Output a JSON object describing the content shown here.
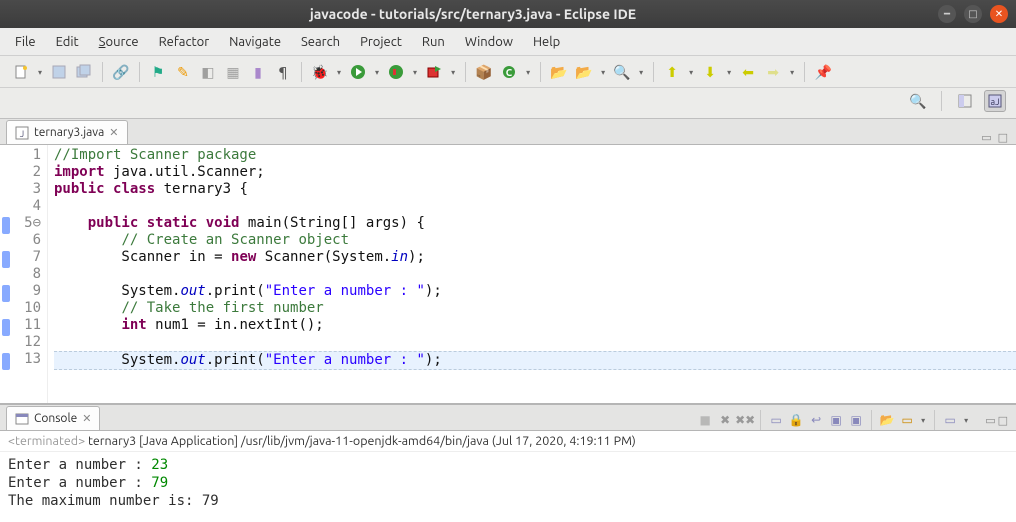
{
  "window": {
    "title": "javacode - tutorials/src/ternary3.java - Eclipse IDE"
  },
  "menu": [
    "File",
    "Edit",
    "Source",
    "Refactor",
    "Navigate",
    "Search",
    "Project",
    "Run",
    "Window",
    "Help"
  ],
  "editor": {
    "tab_label": "ternary3.java",
    "lines": [
      {
        "n": "1",
        "html": "<span class='comment'>//Import Scanner package</span>"
      },
      {
        "n": "2",
        "html": "<span class='kw'>import</span> java.util.Scanner;"
      },
      {
        "n": "3",
        "html": "<span class='kw'>public</span> <span class='kw'>class</span> ternary3 {"
      },
      {
        "n": "4",
        "html": ""
      },
      {
        "n": "5⊖",
        "html": "    <span class='kw'>public</span> <span class='kw'>static</span> <span class='kw'>void</span> main(String[] args) {",
        "marker": true
      },
      {
        "n": "6",
        "html": "        <span class='comment'>// Create an Scanner object</span>"
      },
      {
        "n": "7",
        "html": "        Scanner in = <span class='kw'>new</span> Scanner(System.<span class='field'>in</span>);",
        "marker": true
      },
      {
        "n": "8",
        "html": ""
      },
      {
        "n": "9",
        "html": "        System.<span class='field'>out</span>.print(<span class='str'>\"Enter a number : \"</span>);",
        "marker": true
      },
      {
        "n": "10",
        "html": "        <span class='comment'>// Take the first number</span>"
      },
      {
        "n": "11",
        "html": "        <span class='kw'>int</span> num1 = in.nextInt();",
        "marker": true
      },
      {
        "n": "12",
        "html": ""
      },
      {
        "n": "13",
        "html": "        System.<span class='field'>out</span>.print(<span class='str'>\"Enter a number : \"</span>);",
        "marker": true,
        "current": true
      }
    ]
  },
  "console": {
    "tab_label": "Console",
    "status_prefix": "<terminated>",
    "status_rest": " ternary3 [Java Application] /usr/lib/jvm/java-11-openjdk-amd64/bin/java (Jul 17, 2020, 4:19:11 PM)",
    "l1_text": "Enter a number : ",
    "l1_val": "23",
    "l2_text": "Enter a number : ",
    "l2_val": "79",
    "l3": "The maximum number is: 79"
  }
}
